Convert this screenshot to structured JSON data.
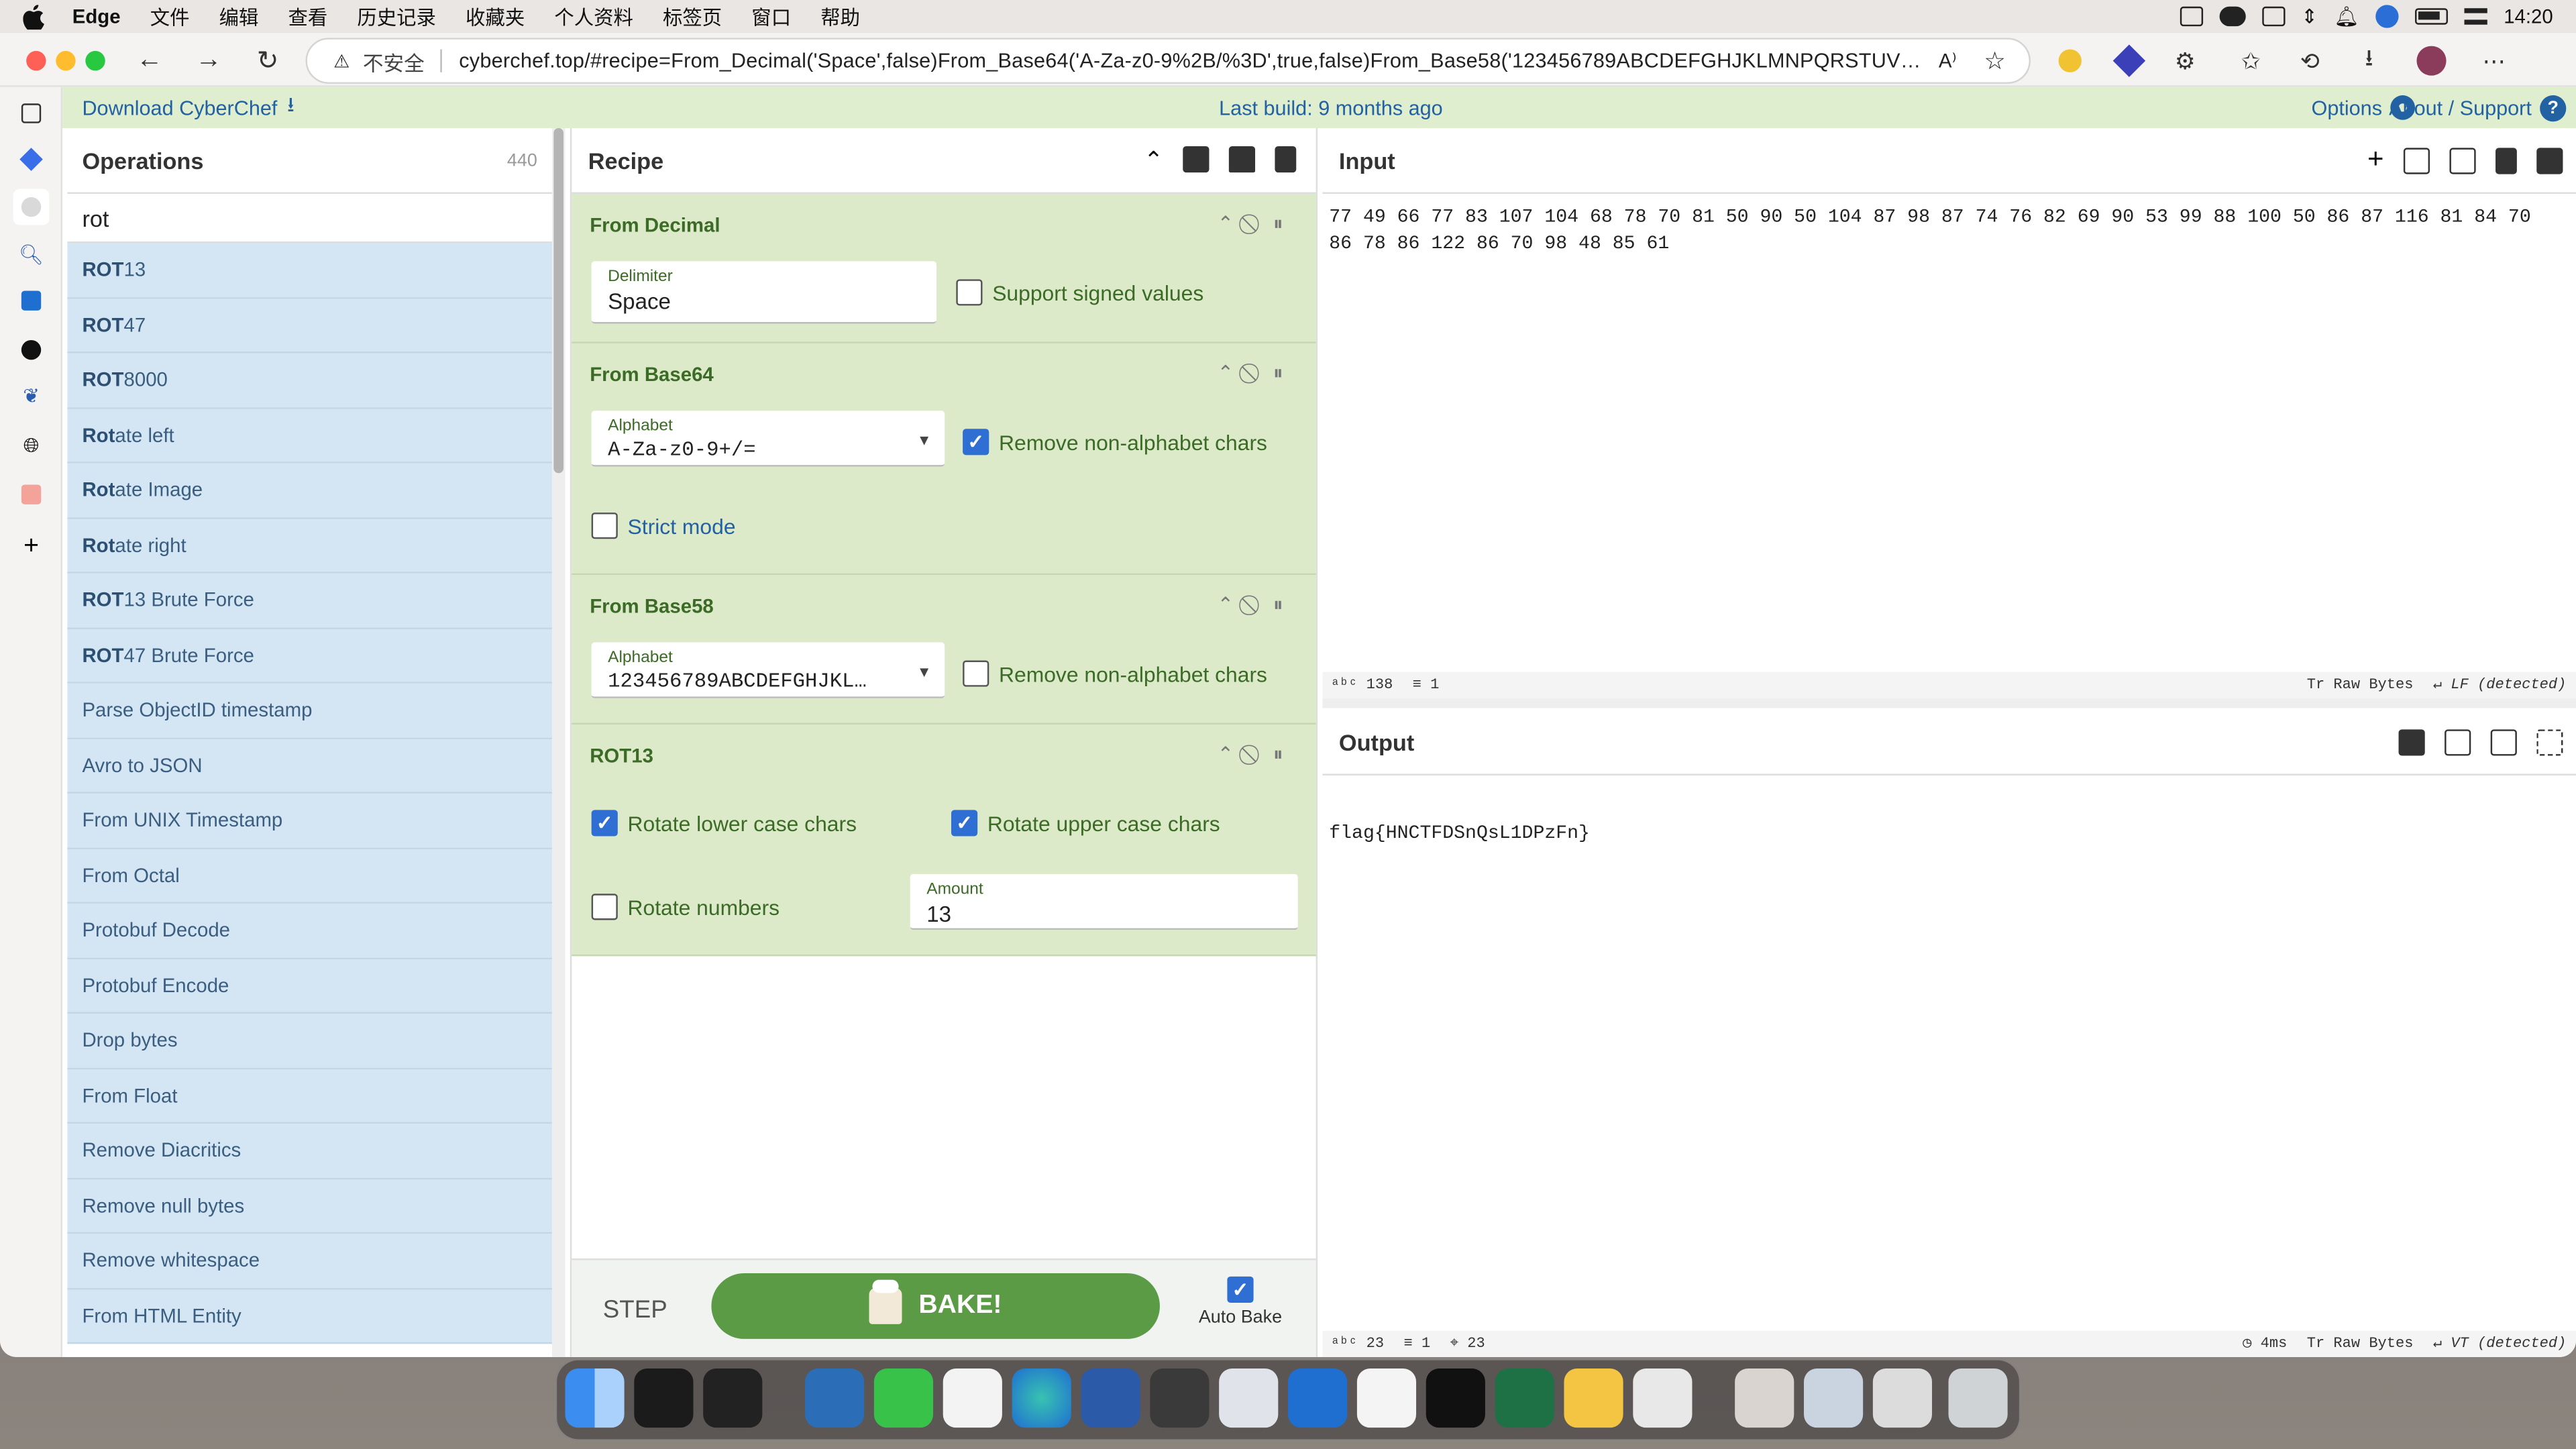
{
  "menubar": {
    "app": "Edge",
    "items": [
      "文件",
      "编辑",
      "查看",
      "历史记录",
      "收藏夹",
      "个人资料",
      "标签页",
      "窗口",
      "帮助"
    ],
    "time": "14:20"
  },
  "browser": {
    "insecure_label": "不安全",
    "url": "cyberchef.top/#recipe=From_Decimal('Space',false)From_Base64('A-Za-z0-9%2B/%3D',true,false)From_Base58('123456789ABCDEFGHJKLMNPQRSTUVWXYZa..."
  },
  "banner": {
    "download": "Download CyberChef",
    "last_build": "Last build: 9 months ago",
    "options": "Options",
    "about": "About / Support"
  },
  "operations": {
    "title": "Operations",
    "count": "440",
    "search_value": "rot",
    "items": [
      {
        "b": "ROT",
        "r": "13"
      },
      {
        "b": "ROT",
        "r": "47"
      },
      {
        "b": "ROT",
        "r": "8000"
      },
      {
        "b": "Rot",
        "r": "ate left"
      },
      {
        "b": "Rot",
        "r": "ate Image"
      },
      {
        "b": "Rot",
        "r": "ate right"
      },
      {
        "b": "ROT",
        "r": "13 Brute Force"
      },
      {
        "b": "ROT",
        "r": "47 Brute Force"
      },
      {
        "b": "",
        "r": "Parse ObjectID timestamp"
      },
      {
        "b": "",
        "r": "Avro to JSON"
      },
      {
        "b": "",
        "r": "From UNIX Timestamp"
      },
      {
        "b": "",
        "r": "From Octal"
      },
      {
        "b": "",
        "r": "Protobuf Decode"
      },
      {
        "b": "",
        "r": "Protobuf Encode"
      },
      {
        "b": "",
        "r": "Drop bytes"
      },
      {
        "b": "",
        "r": "From Float"
      },
      {
        "b": "",
        "r": "Remove Diacritics"
      },
      {
        "b": "",
        "r": "Remove null bytes"
      },
      {
        "b": "",
        "r": "Remove whitespace"
      },
      {
        "b": "",
        "r": "From HTML Entity"
      }
    ]
  },
  "recipe": {
    "title": "Recipe",
    "from_decimal": {
      "name": "From Decimal",
      "delimiter_label": "Delimiter",
      "delimiter": "Space",
      "signed": "Support signed values"
    },
    "from_base64": {
      "name": "From Base64",
      "alphabet_label": "Alphabet",
      "alphabet": "A-Za-z0-9+/=",
      "remove": "Remove non-alphabet chars",
      "strict": "Strict mode"
    },
    "from_base58": {
      "name": "From Base58",
      "alphabet_label": "Alphabet",
      "alphabet": "123456789ABCDEFGHJKL…",
      "remove": "Remove non-alphabet chars"
    },
    "rot13": {
      "name": "ROT13",
      "lower": "Rotate lower case chars",
      "upper": "Rotate upper case chars",
      "numbers": "Rotate numbers",
      "amount_label": "Amount",
      "amount": "13"
    },
    "step": "STEP",
    "bake": "BAKE!",
    "autobake": "Auto Bake"
  },
  "input": {
    "title": "Input",
    "text": "77 49 66 77 83 107 104 68 78 70 81 50 90 50 104 87 98 87 74 76 82 69 90 53 99 88 100 50 86 87 116 81 84 70 86 78 86 122 86 70 98 48 85 61",
    "status_chars": "138",
    "status_lines": "1",
    "raw": "Raw Bytes",
    "eol": "LF (detected)"
  },
  "output": {
    "title": "Output",
    "text": "flag{HNCTFDSnQsL1DPzFn}",
    "status_chars": "23",
    "status_lines": "1",
    "status_pos": "23",
    "time": "4ms",
    "raw": "Raw Bytes",
    "eol": "VT (detected)"
  }
}
